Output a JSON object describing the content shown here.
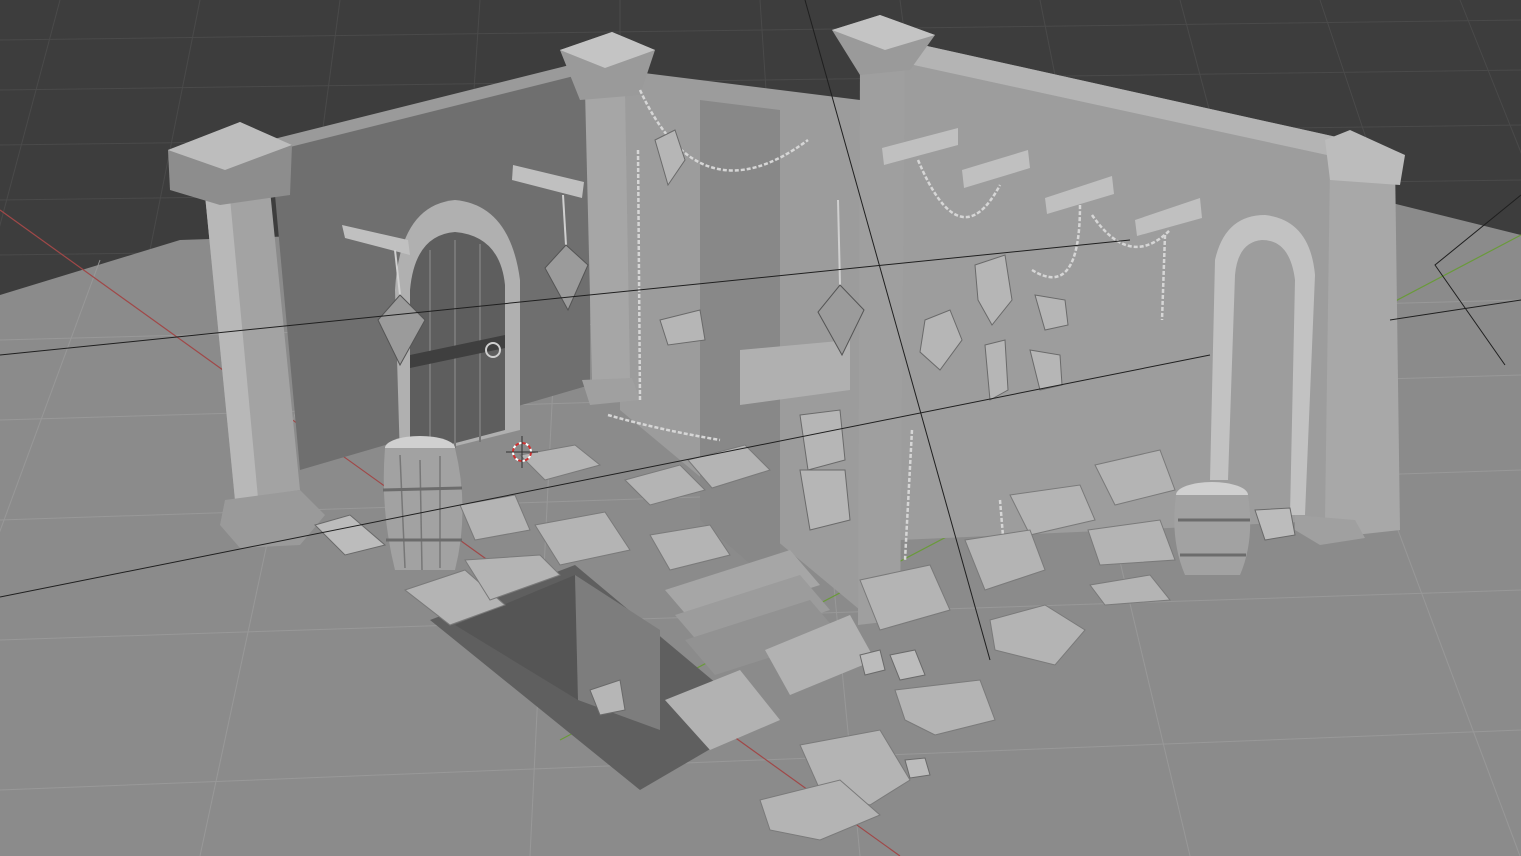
{
  "viewport": {
    "mode": "3d-view",
    "shading": "solid",
    "colors": {
      "background_far": "#3b3b3b",
      "ground": "#8a8a8a",
      "wall_light": "#a8a8a8",
      "wall_mid": "#929292",
      "wall_dark": "#6e6e6e",
      "edge_highlight": "#d8d8d8",
      "grid_line": "#4a4a4a",
      "x_axis": "#a04040",
      "y_axis": "#6a9a3a",
      "cursor": "#d03030"
    }
  },
  "scene": {
    "objects": [
      {
        "name": "pillar-left"
      },
      {
        "name": "pillar-center"
      },
      {
        "name": "pillar-middle"
      },
      {
        "name": "pillar-right"
      },
      {
        "name": "wall-back-left"
      },
      {
        "name": "wall-back-right"
      },
      {
        "name": "wooden-door"
      },
      {
        "name": "archway-right"
      },
      {
        "name": "barrel-left"
      },
      {
        "name": "barrel-right"
      },
      {
        "name": "lantern-left"
      },
      {
        "name": "lantern-center"
      },
      {
        "name": "lantern-right"
      },
      {
        "name": "chains"
      },
      {
        "name": "floor-pit"
      },
      {
        "name": "stairs"
      },
      {
        "name": "floor-tiles"
      }
    ]
  }
}
